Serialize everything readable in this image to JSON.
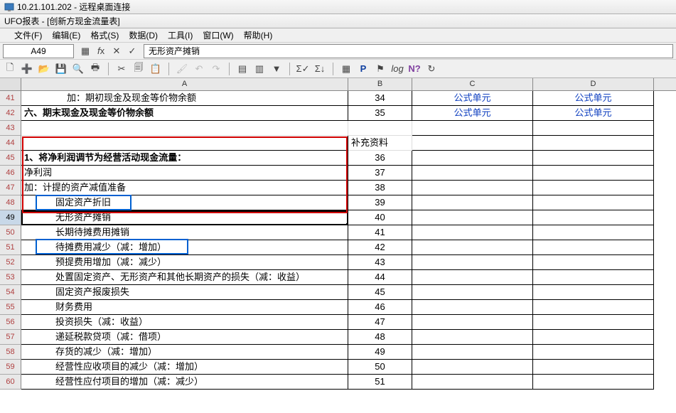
{
  "window": {
    "remote_title": "10.21.101.202 - 远程桌面连接",
    "app_title": "UFO报表 - [创新方现金流量表]"
  },
  "menus": {
    "file": "文件(F)",
    "edit": "编辑(E)",
    "format": "格式(S)",
    "data": "数据(D)",
    "tools": "工具(I)",
    "window": "窗口(W)",
    "help": "帮助(H)"
  },
  "cell_ref": "A49",
  "formula_bar": "无形资产摊销",
  "columns": {
    "A": "A",
    "B": "B",
    "C": "C",
    "D": "D"
  },
  "link_text": "公式单元",
  "rows": [
    {
      "n": "41",
      "a": "加：期初现金及现金等价物余额",
      "ind": "indent-lg",
      "b": "34",
      "c": true,
      "d": true
    },
    {
      "n": "42",
      "a": "六、期末现金及现金等价物余额",
      "ind": "bold",
      "b": "35",
      "c": true,
      "d": true
    },
    {
      "n": "43",
      "a": "",
      "b": "",
      "empty": true
    },
    {
      "n": "44",
      "a": "",
      "b": "补充资料",
      "bspan": true
    },
    {
      "n": "45",
      "a": "1、将净利润调节为经营活动现金流量：",
      "ind": "bold",
      "b": "36"
    },
    {
      "n": "46",
      "a": "净利润",
      "b": "37"
    },
    {
      "n": "47",
      "a": "加：计提的资产减值准备",
      "b": "38"
    },
    {
      "n": "48",
      "a": "固定资产折旧",
      "ind": "indent2",
      "b": "39"
    },
    {
      "n": "49",
      "a": "无形资产摊销",
      "ind": "indent2",
      "b": "40",
      "selected": true
    },
    {
      "n": "50",
      "a": "长期待摊费用摊销",
      "ind": "indent2",
      "b": "41"
    },
    {
      "n": "51",
      "a": "待摊费用减少（减：增加）",
      "ind": "indent2",
      "b": "42"
    },
    {
      "n": "52",
      "a": "预提费用增加（减：减少）",
      "ind": "indent2",
      "b": "43"
    },
    {
      "n": "53",
      "a": "处置固定资产、无形资产和其他长期资产的损失（减：收益）",
      "ind": "indent2",
      "b": "44"
    },
    {
      "n": "54",
      "a": "固定资产报废损失",
      "ind": "indent2",
      "b": "45"
    },
    {
      "n": "55",
      "a": "财务费用",
      "ind": "indent2",
      "b": "46"
    },
    {
      "n": "56",
      "a": "投资损失（减：收益）",
      "ind": "indent2",
      "b": "47"
    },
    {
      "n": "57",
      "a": "递延税款贷项（减：借项）",
      "ind": "indent2",
      "b": "48"
    },
    {
      "n": "58",
      "a": "存货的减少（减：增加）",
      "ind": "indent2",
      "b": "49"
    },
    {
      "n": "59",
      "a": "经营性应收项目的减少（减：增加）",
      "ind": "indent2",
      "b": "50"
    },
    {
      "n": "60",
      "a": "经营性应付项目的增加（减：减少）",
      "ind": "indent2",
      "b": "51"
    }
  ]
}
